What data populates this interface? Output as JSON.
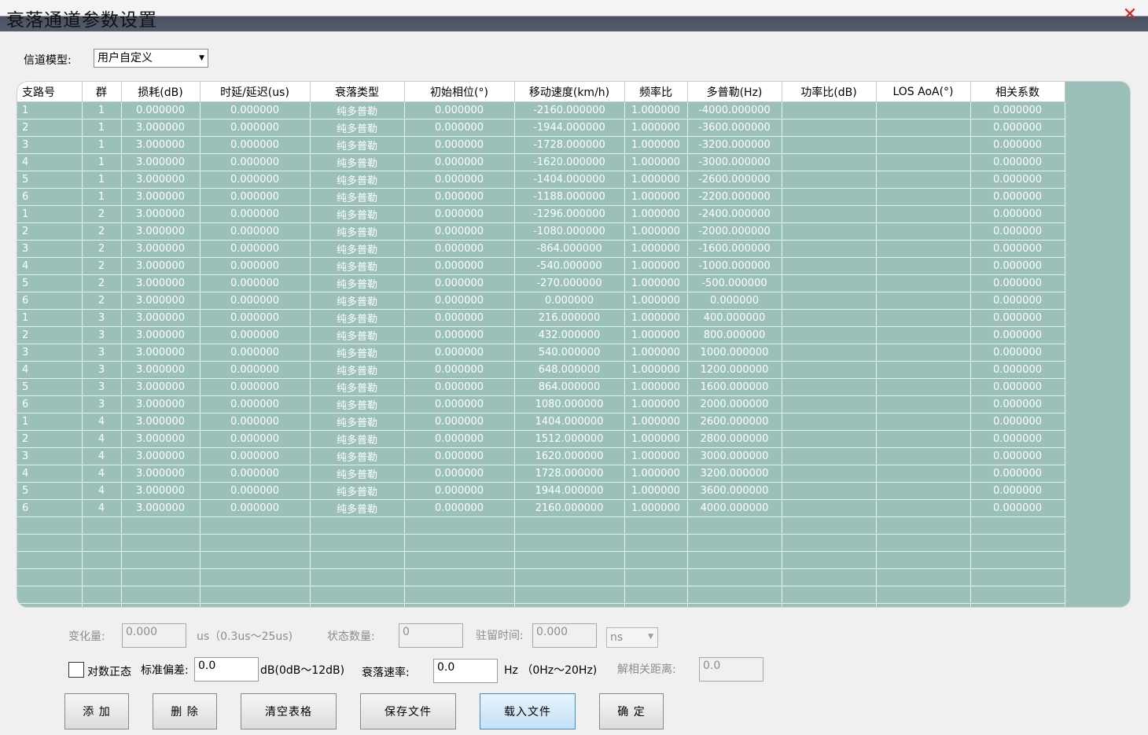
{
  "window": {
    "title": "衰落通道参数设置"
  },
  "channel_model": {
    "label": "信道模型:",
    "value": "用户自定义"
  },
  "table": {
    "columns": [
      "支路号",
      "群",
      "损耗(dB)",
      "时延/延迟(us)",
      "衰落类型",
      "初始相位(°)",
      "移动速度(km/h)",
      "频率比",
      "多普勒(Hz)",
      "功率比(dB)",
      "LOS AoA(°)",
      "相关系数"
    ],
    "rows": [
      [
        "1",
        "1",
        "0.000000",
        "0.000000",
        "纯多普勒",
        "0.000000",
        "-2160.000000",
        "1.000000",
        "-4000.000000",
        "",
        "",
        "0.000000"
      ],
      [
        "2",
        "1",
        "3.000000",
        "0.000000",
        "纯多普勒",
        "0.000000",
        "-1944.000000",
        "1.000000",
        "-3600.000000",
        "",
        "",
        "0.000000"
      ],
      [
        "3",
        "1",
        "3.000000",
        "0.000000",
        "纯多普勒",
        "0.000000",
        "-1728.000000",
        "1.000000",
        "-3200.000000",
        "",
        "",
        "0.000000"
      ],
      [
        "4",
        "1",
        "3.000000",
        "0.000000",
        "纯多普勒",
        "0.000000",
        "-1620.000000",
        "1.000000",
        "-3000.000000",
        "",
        "",
        "0.000000"
      ],
      [
        "5",
        "1",
        "3.000000",
        "0.000000",
        "纯多普勒",
        "0.000000",
        "-1404.000000",
        "1.000000",
        "-2600.000000",
        "",
        "",
        "0.000000"
      ],
      [
        "6",
        "1",
        "3.000000",
        "0.000000",
        "纯多普勒",
        "0.000000",
        "-1188.000000",
        "1.000000",
        "-2200.000000",
        "",
        "",
        "0.000000"
      ],
      [
        "1",
        "2",
        "3.000000",
        "0.000000",
        "纯多普勒",
        "0.000000",
        "-1296.000000",
        "1.000000",
        "-2400.000000",
        "",
        "",
        "0.000000"
      ],
      [
        "2",
        "2",
        "3.000000",
        "0.000000",
        "纯多普勒",
        "0.000000",
        "-1080.000000",
        "1.000000",
        "-2000.000000",
        "",
        "",
        "0.000000"
      ],
      [
        "3",
        "2",
        "3.000000",
        "0.000000",
        "纯多普勒",
        "0.000000",
        "-864.000000",
        "1.000000",
        "-1600.000000",
        "",
        "",
        "0.000000"
      ],
      [
        "4",
        "2",
        "3.000000",
        "0.000000",
        "纯多普勒",
        "0.000000",
        "-540.000000",
        "1.000000",
        "-1000.000000",
        "",
        "",
        "0.000000"
      ],
      [
        "5",
        "2",
        "3.000000",
        "0.000000",
        "纯多普勒",
        "0.000000",
        "-270.000000",
        "1.000000",
        "-500.000000",
        "",
        "",
        "0.000000"
      ],
      [
        "6",
        "2",
        "3.000000",
        "0.000000",
        "纯多普勒",
        "0.000000",
        "0.000000",
        "1.000000",
        "0.000000",
        "",
        "",
        "0.000000"
      ],
      [
        "1",
        "3",
        "3.000000",
        "0.000000",
        "纯多普勒",
        "0.000000",
        "216.000000",
        "1.000000",
        "400.000000",
        "",
        "",
        "0.000000"
      ],
      [
        "2",
        "3",
        "3.000000",
        "0.000000",
        "纯多普勒",
        "0.000000",
        "432.000000",
        "1.000000",
        "800.000000",
        "",
        "",
        "0.000000"
      ],
      [
        "3",
        "3",
        "3.000000",
        "0.000000",
        "纯多普勒",
        "0.000000",
        "540.000000",
        "1.000000",
        "1000.000000",
        "",
        "",
        "0.000000"
      ],
      [
        "4",
        "3",
        "3.000000",
        "0.000000",
        "纯多普勒",
        "0.000000",
        "648.000000",
        "1.000000",
        "1200.000000",
        "",
        "",
        "0.000000"
      ],
      [
        "5",
        "3",
        "3.000000",
        "0.000000",
        "纯多普勒",
        "0.000000",
        "864.000000",
        "1.000000",
        "1600.000000",
        "",
        "",
        "0.000000"
      ],
      [
        "6",
        "3",
        "3.000000",
        "0.000000",
        "纯多普勒",
        "0.000000",
        "1080.000000",
        "1.000000",
        "2000.000000",
        "",
        "",
        "0.000000"
      ],
      [
        "1",
        "4",
        "3.000000",
        "0.000000",
        "纯多普勒",
        "0.000000",
        "1404.000000",
        "1.000000",
        "2600.000000",
        "",
        "",
        "0.000000"
      ],
      [
        "2",
        "4",
        "3.000000",
        "0.000000",
        "纯多普勒",
        "0.000000",
        "1512.000000",
        "1.000000",
        "2800.000000",
        "",
        "",
        "0.000000"
      ],
      [
        "3",
        "4",
        "3.000000",
        "0.000000",
        "纯多普勒",
        "0.000000",
        "1620.000000",
        "1.000000",
        "3000.000000",
        "",
        "",
        "0.000000"
      ],
      [
        "4",
        "4",
        "3.000000",
        "0.000000",
        "纯多普勒",
        "0.000000",
        "1728.000000",
        "1.000000",
        "3200.000000",
        "",
        "",
        "0.000000"
      ],
      [
        "5",
        "4",
        "3.000000",
        "0.000000",
        "纯多普勒",
        "0.000000",
        "1944.000000",
        "1.000000",
        "3600.000000",
        "",
        "",
        "0.000000"
      ],
      [
        "6",
        "4",
        "3.000000",
        "0.000000",
        "纯多普勒",
        "0.000000",
        "2160.000000",
        "1.000000",
        "4000.000000",
        "",
        "",
        "0.000000"
      ]
    ]
  },
  "params": {
    "variation_label": "变化量:",
    "variation_value": "0.000",
    "variation_unit": "us（0.3us～25us)",
    "state_count_label": "状态数量:",
    "state_count_value": "0",
    "dwell_label": "驻留时间:",
    "dwell_value": "0.000",
    "dwell_unit": "ns",
    "lognormal_label": "对数正态",
    "std_dev_label": "标准偏差:",
    "std_dev_value": "0.0",
    "std_dev_unit": "dB(0dB～12dB)",
    "fading_rate_label": "衰落速率:",
    "fading_rate_value": "0.0",
    "fading_rate_unit": "Hz （0Hz～20Hz)",
    "decorrelation_label": "解相关距离:",
    "decorrelation_value": "0.0"
  },
  "buttons": {
    "add": "添 加",
    "delete": "删 除",
    "clear": "清空表格",
    "save": "保存文件",
    "load": "载入文件",
    "ok": "确 定"
  }
}
